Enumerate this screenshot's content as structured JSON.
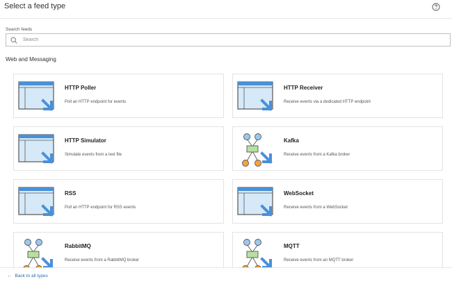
{
  "header": {
    "title": "Select a feed type",
    "help_icon": "question-circle-icon"
  },
  "search": {
    "label": "Search feeds",
    "placeholder": "Search",
    "value": ""
  },
  "section": {
    "title": "Web and Messaging"
  },
  "cards": [
    {
      "title": "HTTP Poller",
      "desc": "Poll an HTTP endpoint for events",
      "icon": "window-arrow-icon"
    },
    {
      "title": "HTTP Receiver",
      "desc": "Receive events via a dedicated HTTP endpoint",
      "icon": "window-arrow-icon"
    },
    {
      "title": "HTTP Simulator",
      "desc": "Simulate events from a text file",
      "icon": "window-arrow-icon"
    },
    {
      "title": "Kafka",
      "desc": "Receive events from a Kafka broker",
      "icon": "broker-network-icon"
    },
    {
      "title": "RSS",
      "desc": "Poll an HTTP endpoint for RSS events",
      "icon": "window-arrow-icon"
    },
    {
      "title": "WebSocket",
      "desc": "Receive events from a WebSocket",
      "icon": "window-arrow-icon"
    },
    {
      "title": "RabbitMQ",
      "desc": "Receive events from a RabbitMQ broker",
      "icon": "broker-network-icon"
    },
    {
      "title": "MQTT",
      "desc": "Receive events from an MQTT broker",
      "icon": "broker-network-icon"
    }
  ],
  "footer": {
    "back_label": "Back to all types",
    "back_arrow": "←"
  },
  "colors": {
    "accent": "#4a90d9",
    "window_fill": "#d6e9f8",
    "node_blue": "#9cc8ee",
    "node_green": "#b7e0a1",
    "node_orange": "#f5a43d"
  }
}
